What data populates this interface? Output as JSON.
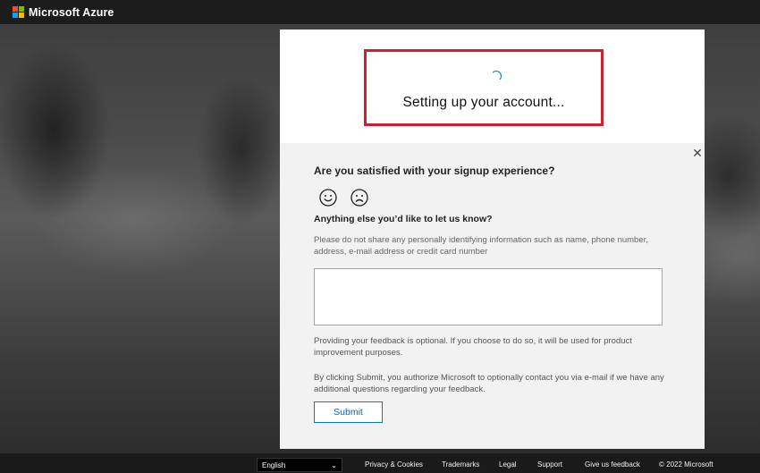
{
  "header": {
    "brand": "Microsoft Azure"
  },
  "dialog": {
    "status_text": "Setting up your account...",
    "feedback": {
      "question": "Are you satisfied with your signup experience?",
      "happy_icon": "smile-icon",
      "sad_icon": "frown-icon",
      "followup": "Anything else you’d like to let us know?",
      "hint": "Please do not share any personally identifying information such as name, phone number, address, e-mail address or credit card number",
      "input_value": "",
      "note_optional": "Providing your feedback is optional. If you choose to do so, it will be used for product improvement purposes.",
      "note_consent": "By clicking Submit, you authorize Microsoft to optionally contact you via e-mail if we have any additional questions regarding your feedback.",
      "submit_label": "Submit"
    }
  },
  "footer": {
    "language": "English",
    "links": {
      "privacy": "Privacy & Cookies",
      "trademarks": "Trademarks",
      "legal": "Legal",
      "support": "Support",
      "feedback": "Give us feedback"
    },
    "copyright": "© 2022 Microsoft"
  },
  "colors": {
    "highlight": "#d0202d",
    "accent": "#0078d4",
    "header_bg": "#1c1c1c"
  }
}
